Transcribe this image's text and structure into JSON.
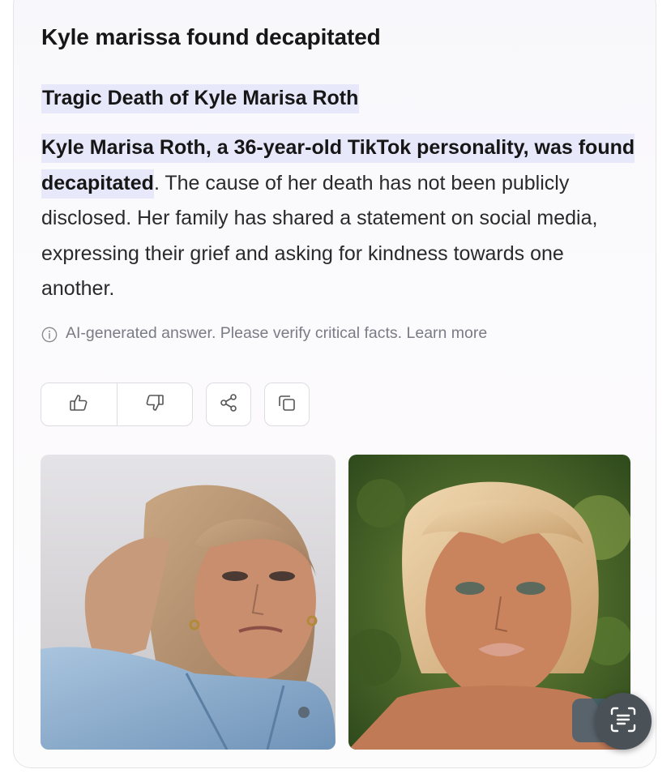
{
  "answer": {
    "title": "Kyle marissa found decapitated",
    "subtitle": "Tragic Death of Kyle Marisa Roth",
    "highlight": "Kyle Marisa Roth, a 36-year-old TikTok personality, was found decapitated",
    "body_rest": ". The cause of her death has not been publicly disclosed. Her family has shared a statement on social media, expressing their grief and asking for kindness towards one another.",
    "disclaimer": "AI-generated answer. Please verify critical facts. Learn more"
  },
  "actions": {
    "icons": [
      "thumbs-up-icon",
      "thumbs-down-icon",
      "share-icon",
      "copy-icon"
    ]
  },
  "images": [
    {
      "name": "photo-woman-denim-jacket"
    },
    {
      "name": "photo-woman-outdoors"
    }
  ],
  "colors": {
    "highlight": "#e8e8fb",
    "text": "#161616",
    "muted": "#7b7b85",
    "border": "#dcdce2"
  }
}
